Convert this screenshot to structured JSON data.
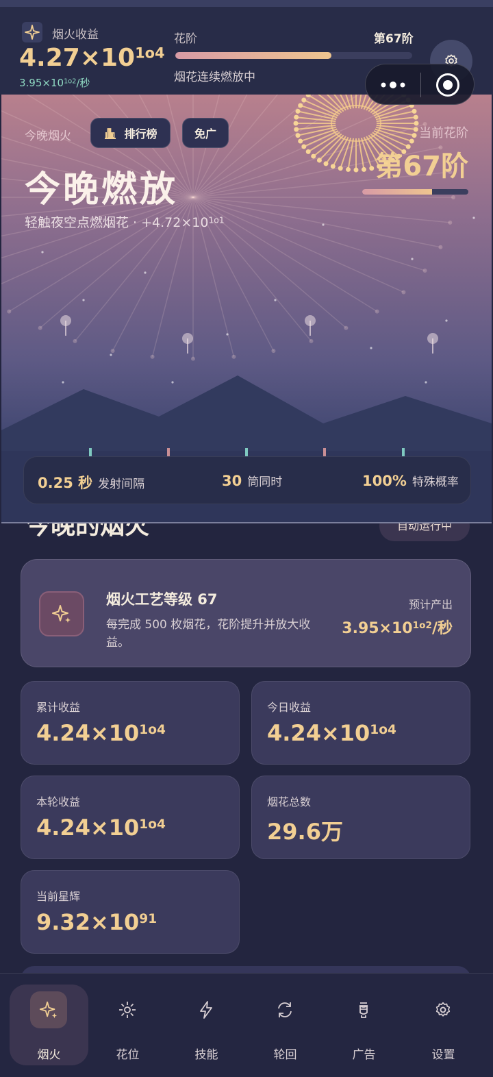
{
  "header": {
    "income_label": "烟火收益",
    "income_mantissa": "4.27×10",
    "income_exp": "1o4",
    "rate_mantissa": "3.95×10",
    "rate_exp": "1o2",
    "rate_unit": "/秒",
    "stage_label": "花阶",
    "stage_value": "第67阶",
    "stage_progress": 0.66,
    "stage_status": "烟花连续燃放中"
  },
  "hero": {
    "tag": "今晚烟火",
    "rank_button": "排行榜",
    "noad_button": "免广",
    "title": "今晚燃放",
    "subtitle_prefix": "轻触夜空点燃烟花 · +4.72×10",
    "subtitle_exp": "1o1",
    "current_stage_label": "当前花阶",
    "current_stage_value": "第67阶",
    "current_stage_progress": 0.66
  },
  "launch": {
    "interval_value": "0.25 秒",
    "interval_label": "发射间隔",
    "tubes_value": "30",
    "tubes_label": "筒同时",
    "special_value": "100%",
    "special_label": "特殊概率"
  },
  "section": {
    "title": "今晚的烟火",
    "badge": "自动运行中"
  },
  "craft": {
    "title": "烟火工艺等级 67",
    "desc": "每完成 500 枚烟花，花阶提升并放大收益。",
    "output_label": "预计产出",
    "output_mantissa": "3.95×10",
    "output_exp": "1o2",
    "output_unit": "/秒"
  },
  "stats": [
    {
      "label": "累计收益",
      "mantissa": "4.24×10",
      "exp": "1o4"
    },
    {
      "label": "今日收益",
      "mantissa": "4.24×10",
      "exp": "1o4"
    },
    {
      "label": "本轮收益",
      "mantissa": "4.24×10",
      "exp": "1o4"
    },
    {
      "label": "烟花总数",
      "mantissa": "29.6万",
      "exp": ""
    },
    {
      "label": "当前星辉",
      "mantissa": "9.32×10",
      "exp": "91"
    }
  ],
  "tabs": [
    {
      "label": "烟火",
      "icon": "sparkle-icon",
      "active": true
    },
    {
      "label": "花位",
      "icon": "sun-icon",
      "active": false
    },
    {
      "label": "技能",
      "icon": "lightning-icon",
      "active": false
    },
    {
      "label": "轮回",
      "icon": "refresh-icon",
      "active": false
    },
    {
      "label": "广告",
      "icon": "lantern-icon",
      "active": false
    },
    {
      "label": "设置",
      "icon": "gear-icon",
      "active": false
    }
  ],
  "colors": {
    "accent_gold": "#f2cf93",
    "rate_green": "#8fd9c2",
    "background": "#23253f"
  }
}
